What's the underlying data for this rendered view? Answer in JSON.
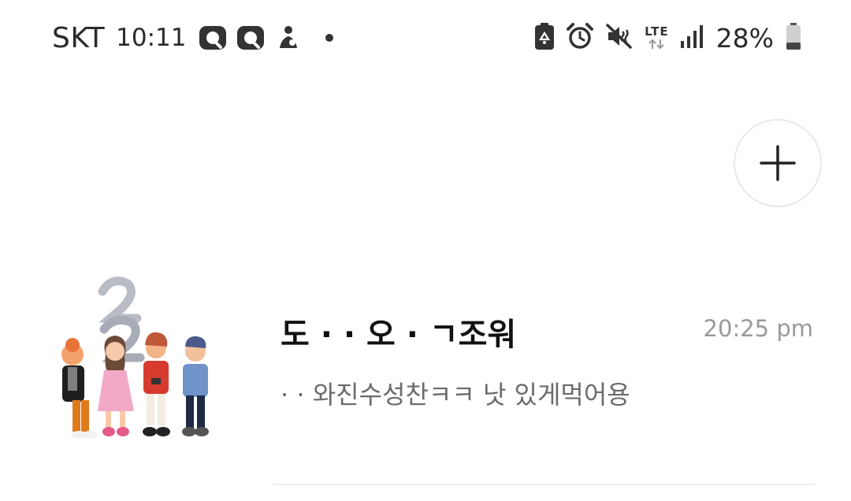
{
  "status_bar": {
    "carrier": "SKT",
    "time": "10:11",
    "notifications": [
      "talk-icon",
      "talk-icon",
      "person-icon",
      "more-dot-icon"
    ],
    "system_icons": [
      "battery-saver-icon",
      "alarm-icon",
      "mute-icon",
      "lte-icon",
      "signal-icon",
      "battery-icon"
    ],
    "lte_label": "LTE",
    "battery_percent": "28%",
    "battery_level": 0.28
  },
  "add_button": {
    "icon": "plus-icon"
  },
  "chat": {
    "name": "도 ·  · 오 · ㄱ조워",
    "time": "20:25 pm",
    "preview": "·  · 와진수성찬ㅋㅋ 낫 있게먹어용",
    "avatar_icon": "group-avatar-icon"
  },
  "colors": {
    "text_primary": "#111111",
    "text_secondary": "#6b6b6b",
    "time_gray": "#9a9a9a",
    "button_border": "#e9e9e9"
  }
}
